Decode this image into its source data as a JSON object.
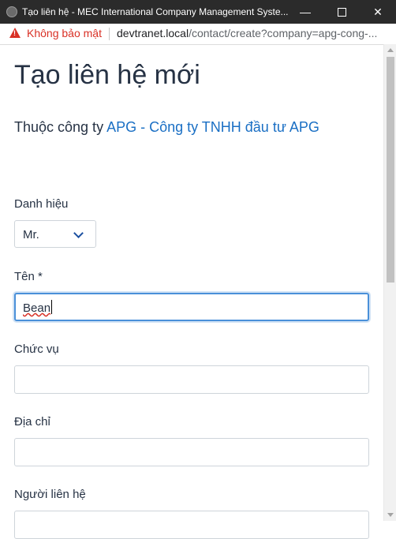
{
  "window": {
    "title": "Tạo liên hệ - MEC International Company Management Syste...",
    "minimize": "—",
    "close": "✕"
  },
  "address": {
    "warning": "Không bảo mật",
    "host": "devtranet.local",
    "path": "/contact/create?company=apg-cong-..."
  },
  "page": {
    "heading": "Tạo liên hệ mới",
    "company_prefix": "Thuộc công ty",
    "company_link": "APG - Công ty TNHH đầu tư APG"
  },
  "form": {
    "title_label": "Danh hiệu",
    "title_value": "Mr.",
    "name_label": "Tên *",
    "name_value": "Bean",
    "position_label": "Chức vụ",
    "position_value": "",
    "address_label": "Địa chỉ",
    "address_value": "",
    "contact_person_label": "Người liên hệ"
  }
}
